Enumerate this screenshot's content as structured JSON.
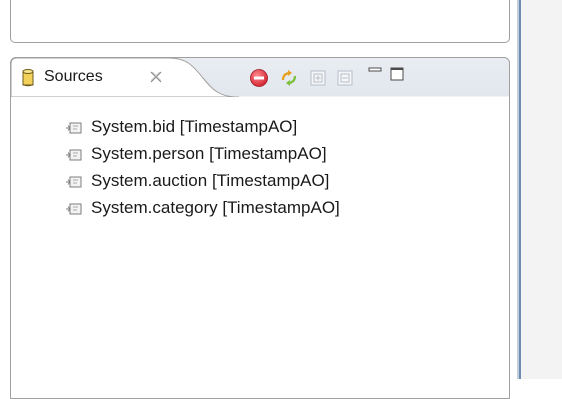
{
  "sources_view": {
    "tab": {
      "title": "Sources",
      "icon": "database-cylinder-icon",
      "close_icon": "close-icon",
      "active_color": "#ffffff"
    },
    "toolbar": [
      {
        "name": "remove-source-button",
        "icon": "red-minus-circle-icon",
        "tooltip_color": "#e8343c"
      },
      {
        "name": "reload-sources-button",
        "icon": "refresh-arrows-icon",
        "tooltip_color": "#e8a12a"
      },
      {
        "name": "expand-all-button",
        "icon": "expand-all-icon"
      },
      {
        "name": "collapse-all-button",
        "icon": "collapse-all-icon"
      },
      {
        "name": "minimize-view-button",
        "icon": "minimize-icon"
      },
      {
        "name": "maximize-view-button",
        "icon": "maximize-icon"
      }
    ],
    "items": [
      {
        "label": "System.bid [TimestampAO]",
        "icon": "source-node-icon"
      },
      {
        "label": "System.person [TimestampAO]",
        "icon": "source-node-icon"
      },
      {
        "label": "System.auction [TimestampAO]",
        "icon": "source-node-icon"
      },
      {
        "label": "System.category [TimestampAO]",
        "icon": "source-node-icon"
      }
    ]
  },
  "colors": {
    "panel_border": "#a0a0a0",
    "toolbar_bg": "#e2e7ee",
    "separator": "#6b8db3"
  }
}
